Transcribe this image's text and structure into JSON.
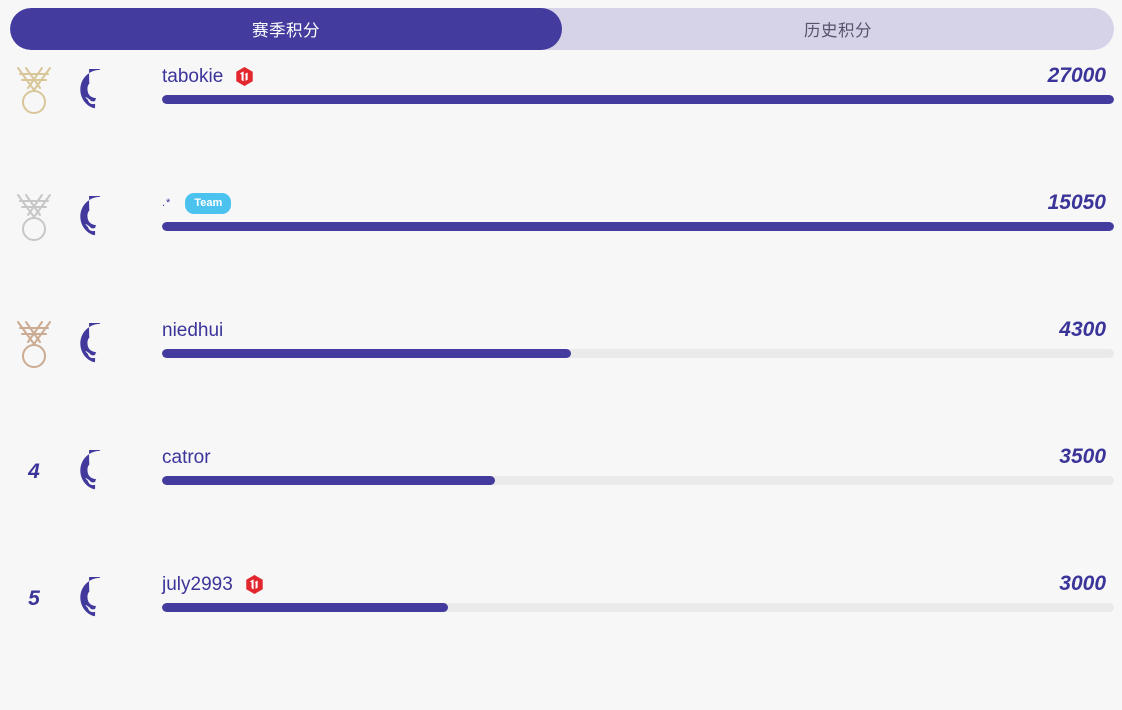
{
  "tabs": [
    {
      "label": "赛季积分",
      "active": true
    },
    {
      "label": "历史积分",
      "active": false
    }
  ],
  "colors": {
    "accent": "#433c9e",
    "text_accent": "#3b3499",
    "tabbar_bg": "#d6d3e8",
    "track": "#eaeaea",
    "team_badge": "#4cc3ef",
    "tidb_badge": "#e3272e",
    "page_bg": "#f7f7f8",
    "medal_gold": "#d9c79a",
    "medal_silver": "#c9c9c9",
    "medal_bronze": "#cbab92"
  },
  "rows": [
    {
      "rank": "1",
      "rank_type": "medal-gold",
      "avatar": "github-avatar",
      "username": "tabokie",
      "username_small": false,
      "badge": "tidb",
      "badge_label": "",
      "score": "27000",
      "bar_percent": 100
    },
    {
      "rank": "2",
      "rank_type": "medal-silver",
      "avatar": "github-avatar",
      "username": ".*",
      "username_small": true,
      "badge": "team",
      "badge_label": "Team",
      "score": "15050",
      "bar_percent": 100
    },
    {
      "rank": "3",
      "rank_type": "medal-bronze",
      "avatar": "github-avatar",
      "username": "niedhui",
      "username_small": false,
      "badge": "none",
      "badge_label": "",
      "score": "4300",
      "bar_percent": 43
    },
    {
      "rank": "4",
      "rank_type": "number",
      "avatar": "github-avatar",
      "username": "catror",
      "username_small": false,
      "badge": "none",
      "badge_label": "",
      "score": "3500",
      "bar_percent": 35
    },
    {
      "rank": "5",
      "rank_type": "number",
      "avatar": "github-avatar",
      "username": "july2993",
      "username_small": false,
      "badge": "tidb",
      "badge_label": "",
      "score": "3000",
      "bar_percent": 30
    }
  ]
}
